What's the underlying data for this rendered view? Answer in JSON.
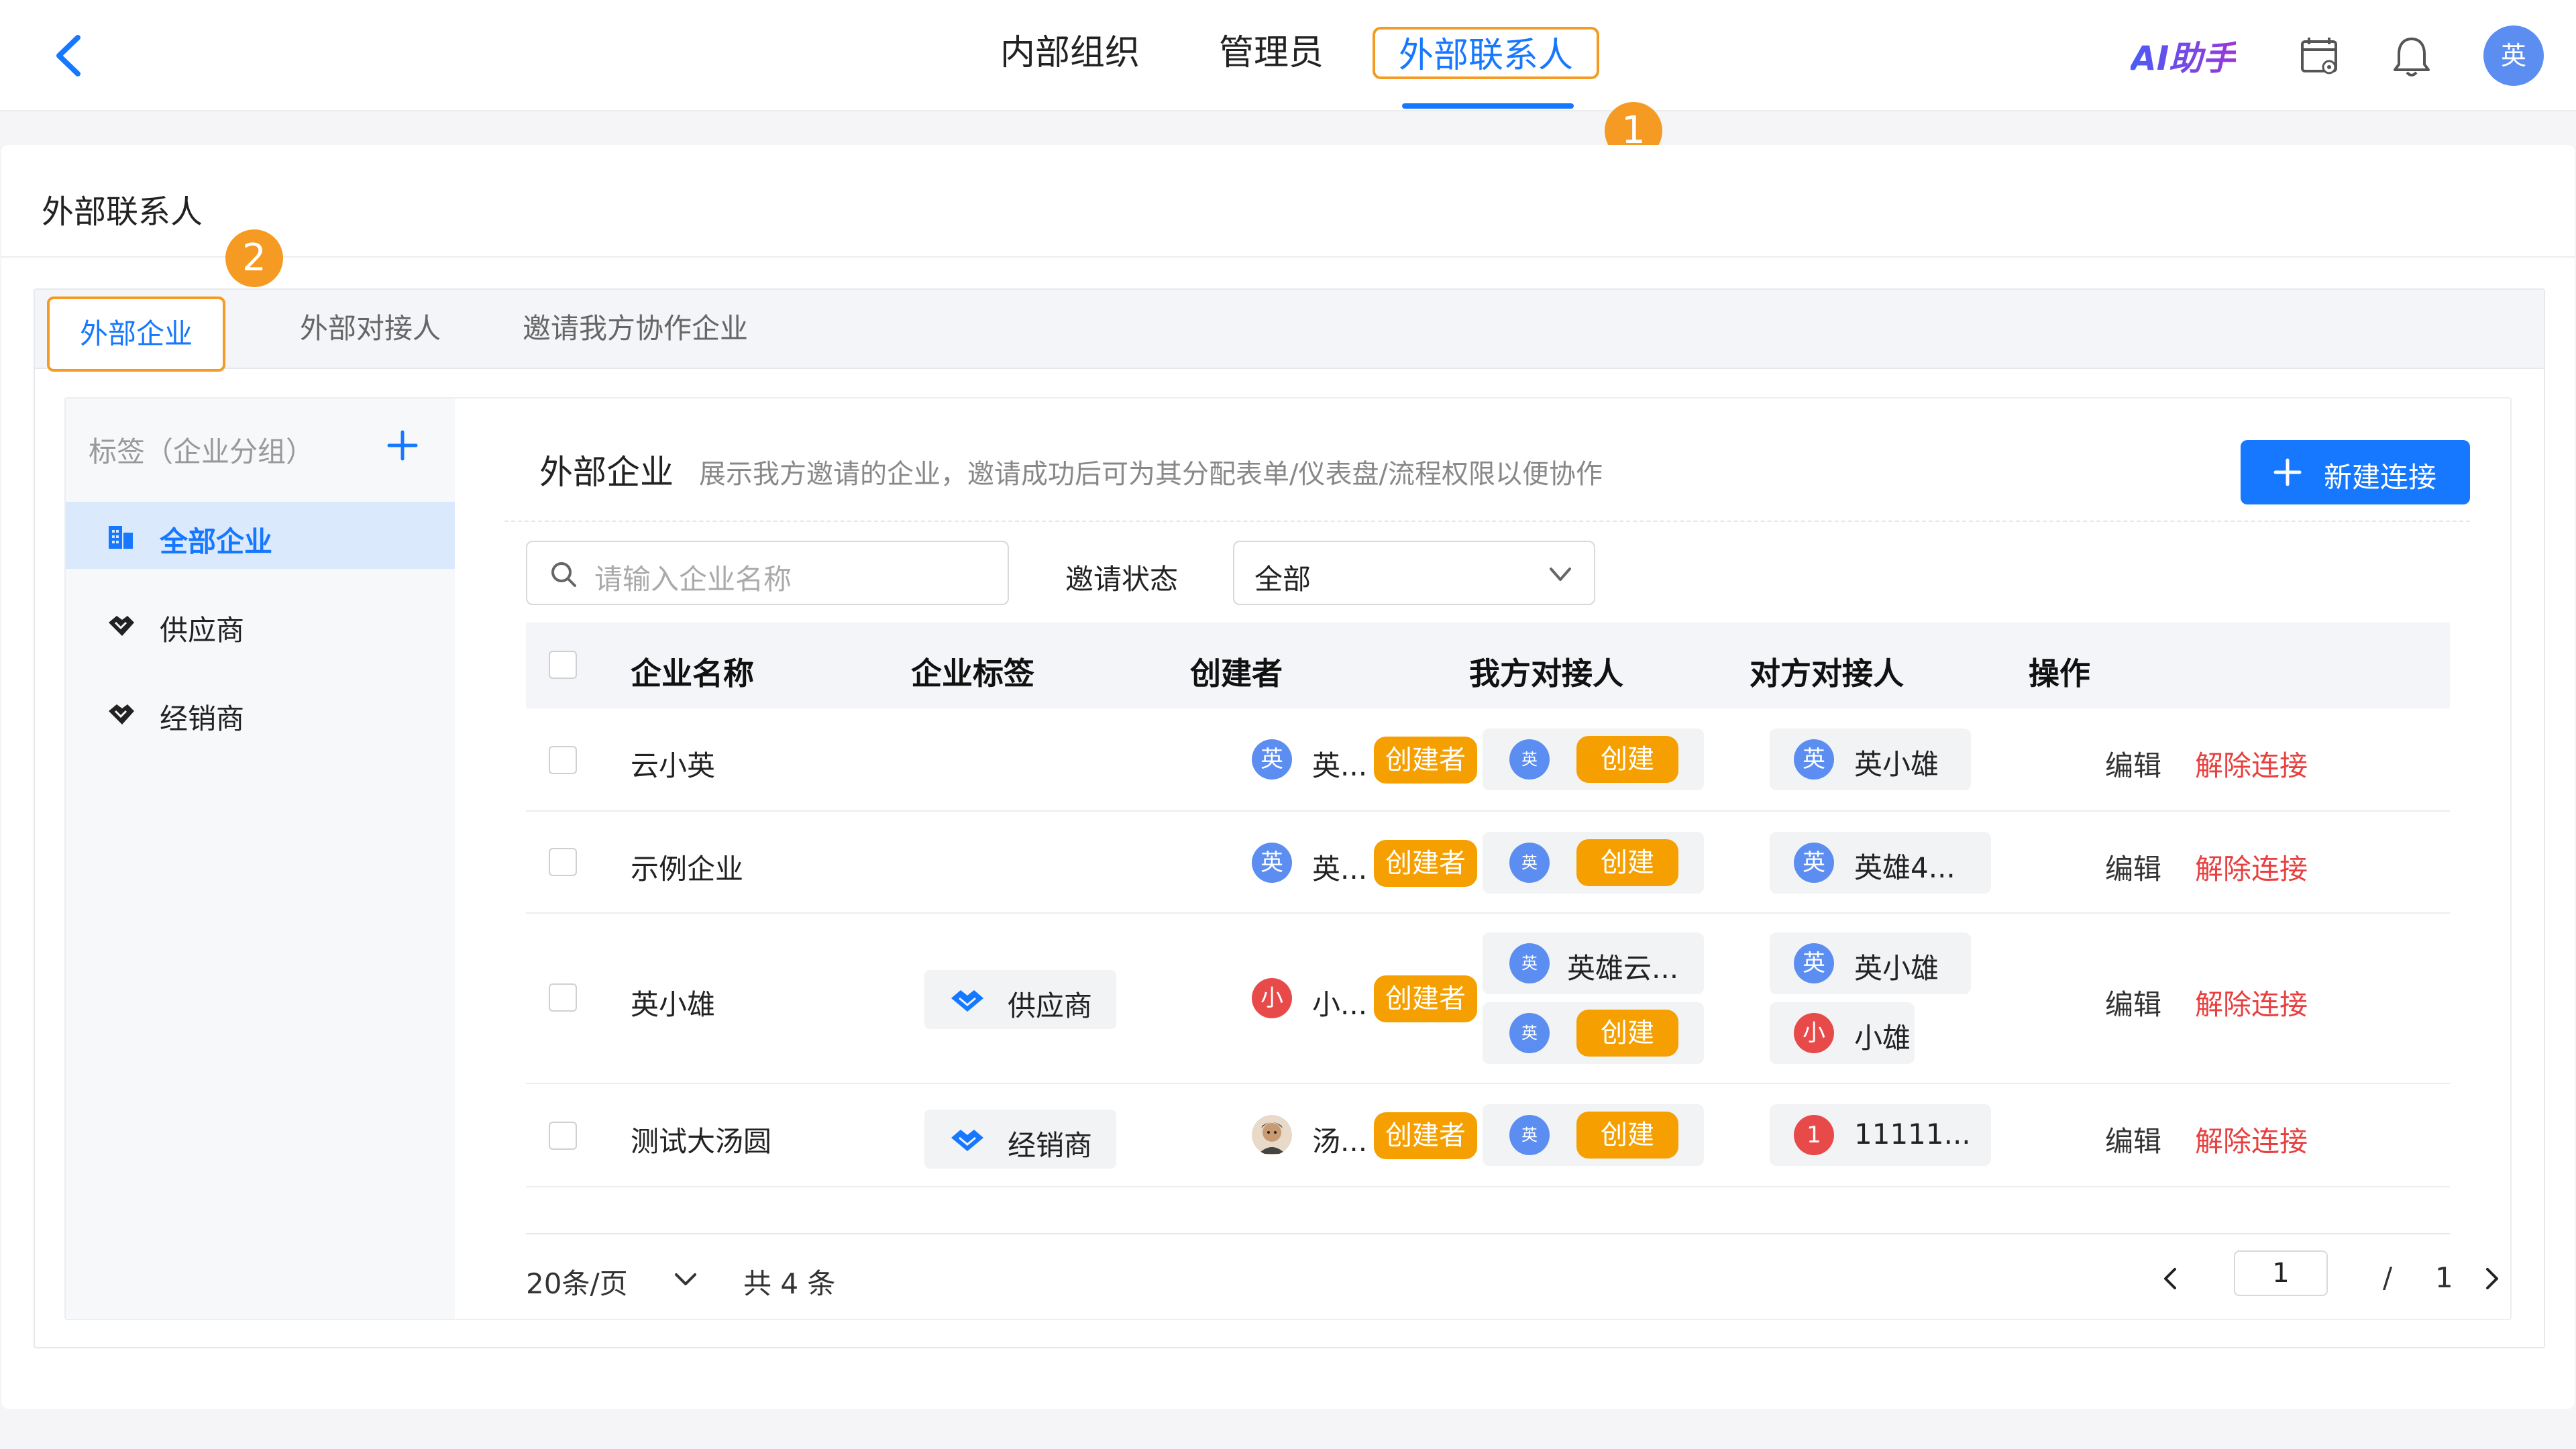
{
  "topnav": {
    "items": [
      {
        "label": "内部组织"
      },
      {
        "label": "管理员"
      },
      {
        "label": "外部联系人"
      }
    ],
    "ai_helper": "AI助手",
    "user_avatar": "英"
  },
  "markers": {
    "one": "1",
    "two": "2"
  },
  "card": {
    "title": "外部联系人",
    "tabs": [
      {
        "label": "外部企业"
      },
      {
        "label": "外部对接人"
      },
      {
        "label": "邀请我方协作企业"
      }
    ]
  },
  "sidebar": {
    "header": "标签（企业分组）",
    "items": [
      {
        "label": "全部企业",
        "icon": "building-icon"
      },
      {
        "label": "供应商",
        "icon": "handshake-icon"
      },
      {
        "label": "经销商",
        "icon": "handshake-icon"
      }
    ]
  },
  "panel": {
    "title": "外部企业",
    "description": "展示我方邀请的企业，邀请成功后可为其分配表单/仪表盘/流程权限以便协作",
    "new_button": "新建连接",
    "search_placeholder": "请输入企业名称",
    "status_label": "邀请状态",
    "status_value": "全部"
  },
  "table": {
    "headers": [
      "企业名称",
      "企业标签",
      "创建者",
      "我方对接人",
      "对方对接人",
      "操作"
    ],
    "rows": [
      {
        "name": "云小英",
        "tag": "",
        "creator": {
          "avatar": "英",
          "name": "英...",
          "badge": "创建者"
        },
        "our_contacts": [
          {
            "avatar": "英",
            "name": "创建",
            "is_badge": true
          }
        ],
        "their_contacts": [
          {
            "avatar": "英",
            "name": "英小雄"
          }
        ],
        "edit": "编辑",
        "unlink": "解除连接"
      },
      {
        "name": "示例企业",
        "tag": "",
        "creator": {
          "avatar": "英",
          "name": "英...",
          "badge": "创建者"
        },
        "our_contacts": [
          {
            "avatar": "英",
            "name": "创建",
            "is_badge": true
          }
        ],
        "their_contacts": [
          {
            "avatar": "英",
            "name": "英雄4..."
          }
        ],
        "edit": "编辑",
        "unlink": "解除连接"
      },
      {
        "name": "英小雄",
        "tag": "供应商",
        "creator": {
          "avatar": "小",
          "name": "小...",
          "badge": "创建者"
        },
        "our_contacts": [
          {
            "avatar": "英",
            "name": "英雄云..."
          },
          {
            "avatar": "英",
            "name": "创建",
            "is_badge": true
          }
        ],
        "their_contacts": [
          {
            "avatar": "英",
            "name": "英小雄"
          },
          {
            "avatar": "小",
            "name": "小雄"
          }
        ],
        "edit": "编辑",
        "unlink": "解除连接"
      },
      {
        "name": "测试大汤圆",
        "tag": "经销商",
        "creator": {
          "avatar": "",
          "name": "汤...",
          "badge": "创建者"
        },
        "our_contacts": [
          {
            "avatar": "英",
            "name": "创建",
            "is_badge": true
          }
        ],
        "their_contacts": [
          {
            "avatar": "1",
            "name": "11111..."
          }
        ],
        "edit": "编辑",
        "unlink": "解除连接"
      }
    ]
  },
  "pagination": {
    "page_size": "20条/页",
    "total": "共 4 条",
    "current": "1",
    "slash": "/",
    "pages": "1"
  },
  "colors": {
    "primary": "#1677ff",
    "highlight_marker": "#f59a23",
    "badge": "#f5a000",
    "danger": "#e84040"
  }
}
